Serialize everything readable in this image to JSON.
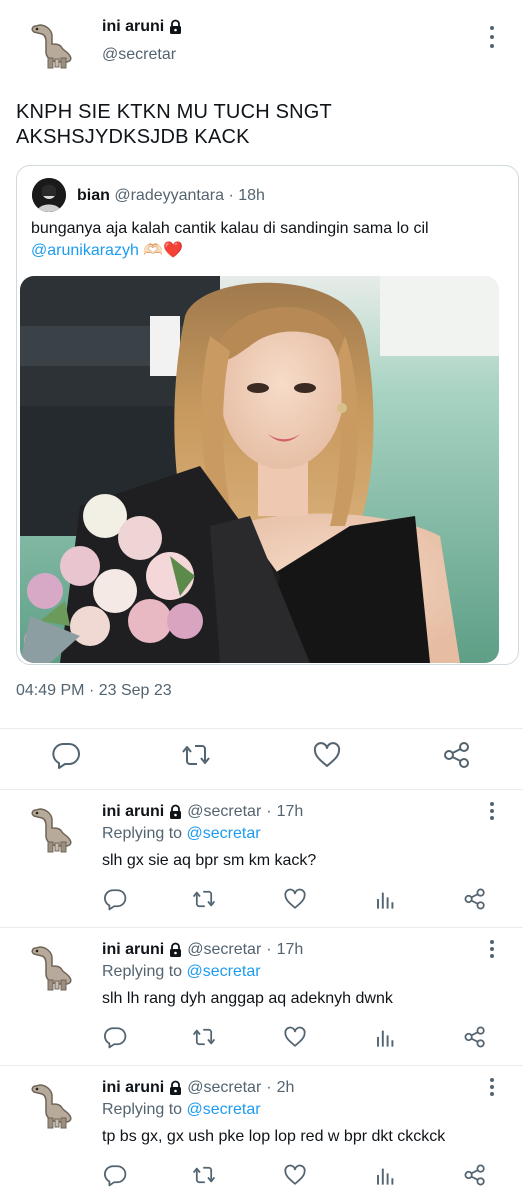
{
  "main_tweet": {
    "author_name": "ini aruni",
    "author_handle": "@secretar",
    "text": "KNPH SIE KTKN MU TUCH SNGT AKSHSJYDKSJDB KACK",
    "timestamp": "04:49 PM",
    "separator": "·",
    "date": "23 Sep 23",
    "quote": {
      "author_name": "bian",
      "author_handle": "@radeyyantara",
      "time": "18h",
      "separator": "·",
      "text": "bunganya aja kalah cantik kalau di sandingin sama lo cil",
      "mention": "@arunikarazyh",
      "emoji": "🫶🏻❤️"
    }
  },
  "replies": [
    {
      "author_name": "ini aruni",
      "author_handle": "@secretar",
      "separator": "·",
      "time": "17h",
      "replying_label": "Replying to",
      "replying_to": "@secretar",
      "text": "slh gx sie aq bpr sm km kack?"
    },
    {
      "author_name": "ini aruni",
      "author_handle": "@secretar",
      "separator": "·",
      "time": "17h",
      "replying_label": "Replying to",
      "replying_to": "@secretar",
      "text": "slh lh rang dyh anggap aq adeknyh dwnk"
    },
    {
      "author_name": "ini aruni",
      "author_handle": "@secretar",
      "separator": "·",
      "time": "2h",
      "replying_label": "Replying to",
      "replying_to": "@secretar",
      "text": "tp bs gx, gx ush pke lop lop red w bpr dkt ckckck"
    }
  ],
  "icons": {
    "reply": "reply-icon",
    "retweet": "retweet-icon",
    "like": "like-icon",
    "views": "views-icon",
    "share": "share-icon",
    "lock": "lock-icon",
    "more": "more-icon"
  },
  "colors": {
    "accent": "#1d9bf0",
    "secondary_text": "#536471",
    "primary_text": "#0f1419",
    "divider": "#e6ecf0"
  }
}
